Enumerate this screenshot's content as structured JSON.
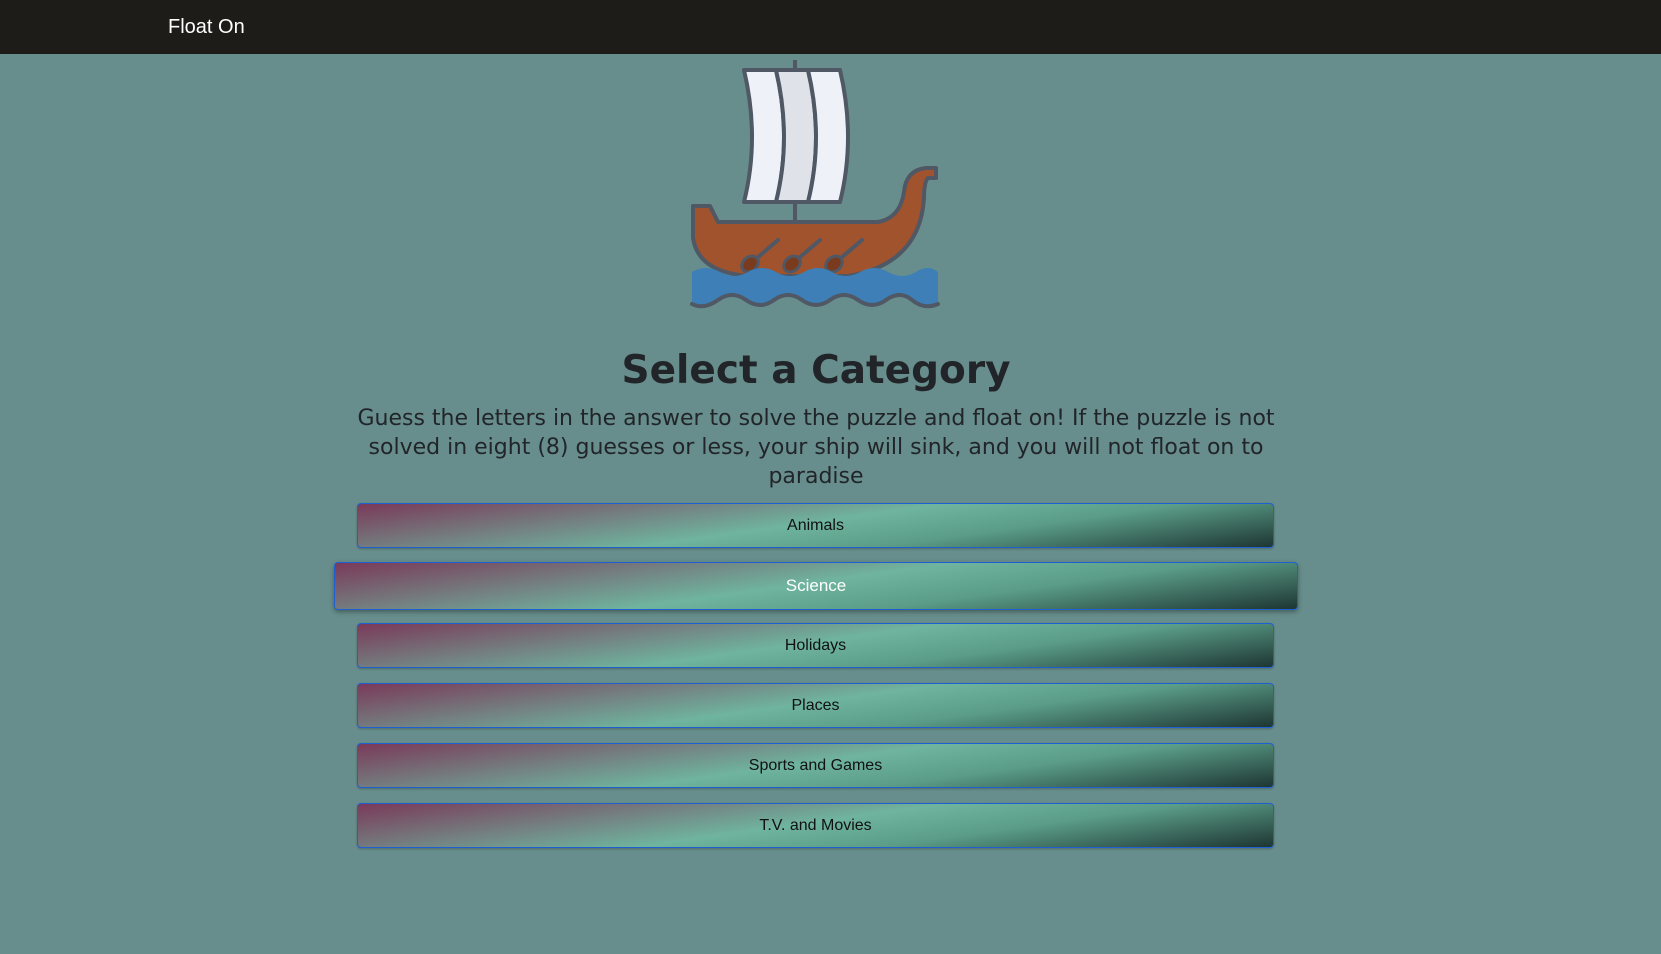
{
  "navbar": {
    "brand": "Float On"
  },
  "logo": {
    "icon": "viking-ship-icon"
  },
  "heading": {
    "title": "Select a Category"
  },
  "instructions": {
    "text": "Guess the letters in the answer to solve the puzzle and float on! If the puzzle is not solved in eight (8) guesses or less, your ship will sink, and you will not float on to paradise"
  },
  "categories": [
    {
      "label": "Animals"
    },
    {
      "label": "Science"
    },
    {
      "label": "Holidays"
    },
    {
      "label": "Places"
    },
    {
      "label": "Sports and Games"
    },
    {
      "label": "T.V. and Movies"
    }
  ],
  "colors": {
    "background": "#678e8c",
    "navbar": "#1e1c18",
    "button_border": "#1f5fd0",
    "hull": "#a0532d",
    "water": "#3d7fb6",
    "sail": "#eef2f8"
  }
}
